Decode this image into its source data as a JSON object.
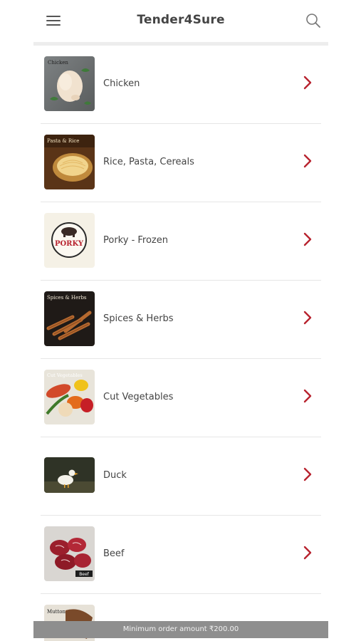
{
  "app": {
    "title": "Tender4Sure"
  },
  "icons": {
    "menu": "hamburger-menu-icon",
    "search": "search-icon",
    "chevron": "chevron-right-icon"
  },
  "colors": {
    "accent": "#b8232f",
    "footer_bg": "#8e8e8e"
  },
  "categories": [
    {
      "label": "Chicken",
      "thumb_text": "Chicken"
    },
    {
      "label": "Rice, Pasta, Cereals",
      "thumb_text": "Pasta & Rice"
    },
    {
      "label": "Porky - Frozen",
      "thumb_text": "PORKY"
    },
    {
      "label": "Spices & Herbs",
      "thumb_text": "Spices & Herbs"
    },
    {
      "label": "Cut Vegetables",
      "thumb_text": "Cut Vegetables"
    },
    {
      "label": "Duck",
      "thumb_text": ""
    },
    {
      "label": "Beef",
      "thumb_text": "Beef"
    },
    {
      "label": "",
      "thumb_text": "Mutton"
    }
  ],
  "footer": {
    "min_order": "Minimum order amount ₹200.00"
  }
}
